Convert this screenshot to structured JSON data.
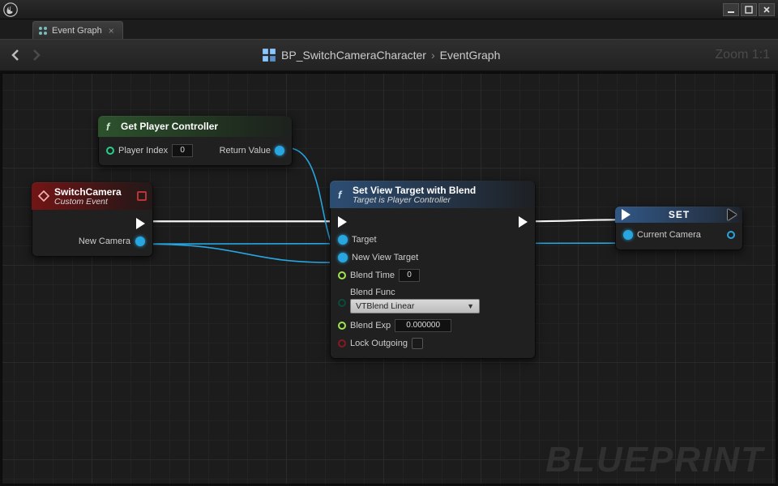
{
  "window": {
    "tab_label": "Event Graph"
  },
  "toolbar": {
    "breadcrumb_root": "BP_SwitchCameraCharacter",
    "breadcrumb_leaf": "EventGraph",
    "zoom_label": "Zoom 1:1"
  },
  "watermark": "BLUEPRINT",
  "nodes": {
    "getPC": {
      "title": "Get Player Controller",
      "pins": {
        "player_index_label": "Player Index",
        "player_index_value": "0",
        "return_label": "Return Value"
      }
    },
    "switchCam": {
      "title": "SwitchCamera",
      "subtitle": "Custom Event",
      "pins": {
        "new_camera_label": "New Camera"
      }
    },
    "setView": {
      "title": "Set View Target with Blend",
      "subtitle": "Target is Player Controller",
      "pins": {
        "target_label": "Target",
        "new_view_target_label": "New View Target",
        "blend_time_label": "Blend Time",
        "blend_time_value": "0",
        "blend_func_label": "Blend Func",
        "blend_func_value": "VTBlend Linear",
        "blend_exp_label": "Blend Exp",
        "blend_exp_value": "0.000000",
        "lock_outgoing_label": "Lock Outgoing"
      }
    },
    "setVar": {
      "title": "SET",
      "pins": {
        "current_camera_label": "Current Camera"
      }
    }
  }
}
